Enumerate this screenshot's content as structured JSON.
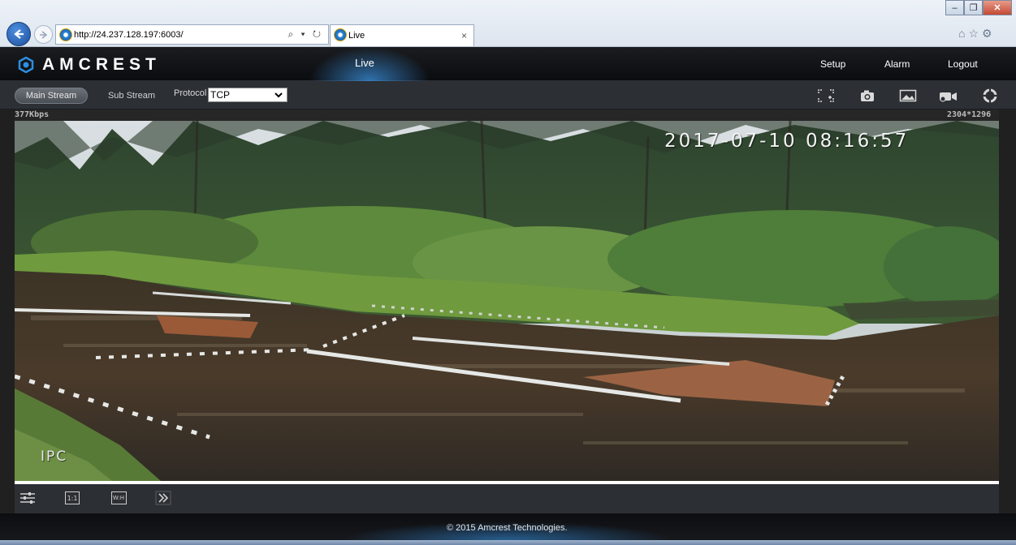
{
  "browser": {
    "url": "http://24.237.128.197:6003/",
    "tab_title": "Live",
    "tab_close": "×",
    "address_tools": "⌕ ▾ ↻",
    "right_tools": "⌂☆⚙",
    "win_min": "–",
    "win_max": "❐",
    "win_close": "✕"
  },
  "header": {
    "logo_text": "AMCREST",
    "active_section": "Live",
    "nav": [
      {
        "label": "Setup"
      },
      {
        "label": "Alarm"
      },
      {
        "label": "Logout"
      }
    ]
  },
  "toolbar": {
    "main_stream": "Main Stream",
    "sub_stream": "Sub Stream",
    "protocol_label": "Protocol",
    "protocol_value": "TCP",
    "tools": [
      "fullscreen-icon",
      "camera-icon",
      "image-icon",
      "record-icon",
      "settings-ring-icon"
    ]
  },
  "video": {
    "bitrate": "377Kbps",
    "resolution": "2304*1296",
    "osd_timestamp": "2017-07-10 08:16:57",
    "osd_name": "IPC"
  },
  "bottom_controls": {
    "icons": [
      "adjust-sliders-icon",
      "ratio-1to1-icon",
      "ratio-wh-icon",
      "zoom-icon"
    ],
    "ratio_1to1": "1:1",
    "ratio_wh": "W:H"
  },
  "footer": {
    "copyright": "© 2015 Amcrest Technologies."
  },
  "colors": {
    "accent_blue": "#2e8ee0",
    "header_bg": "#0f1013",
    "toolbar_bg": "#2c2f34"
  }
}
